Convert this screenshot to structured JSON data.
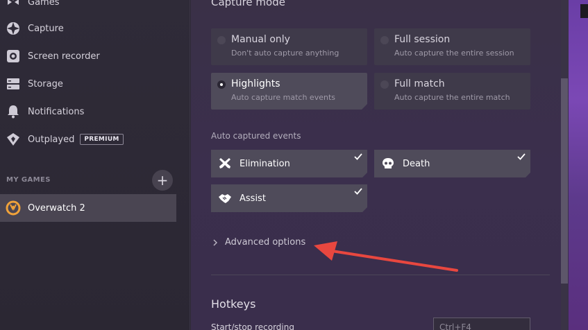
{
  "sidebar": {
    "items": [
      {
        "label": "Games",
        "icon": "gamepad-icon"
      },
      {
        "label": "Capture",
        "icon": "aperture-icon"
      },
      {
        "label": "Screen recorder",
        "icon": "record-icon"
      },
      {
        "label": "Storage",
        "icon": "storage-icon"
      },
      {
        "label": "Notifications",
        "icon": "bell-icon"
      },
      {
        "label": "Outplayed",
        "icon": "outplayed-logo-icon",
        "badge": "PREMIUM"
      }
    ],
    "my_games_label": "MY GAMES",
    "add_game_symbol": "+",
    "games": [
      {
        "label": "Overwatch 2",
        "icon": "overwatch-icon",
        "selected": true
      }
    ]
  },
  "capture_mode": {
    "heading": "Capture mode",
    "options": [
      {
        "title": "Manual only",
        "subtitle": "Don't auto capture anything",
        "selected": false
      },
      {
        "title": "Full session",
        "subtitle": "Auto capture the entire session",
        "selected": false
      },
      {
        "title": "Highlights",
        "subtitle": "Auto capture match events",
        "selected": true
      },
      {
        "title": "Full match",
        "subtitle": "Auto capture the entire match",
        "selected": false
      }
    ]
  },
  "auto_events": {
    "label": "Auto captured events",
    "events": [
      {
        "label": "Elimination",
        "icon": "crossed-guns-icon",
        "checked": true
      },
      {
        "label": "Death",
        "icon": "skull-icon",
        "checked": true
      },
      {
        "label": "Assist",
        "icon": "handshake-icon",
        "checked": true
      }
    ]
  },
  "advanced_options": {
    "label": "Advanced options"
  },
  "hotkeys": {
    "heading": "Hotkeys",
    "start_stop_label": "Start/stop recording",
    "start_stop_value": "Ctrl+F4"
  },
  "colors": {
    "accent_arrow": "#e8473f",
    "selected_card": "#4f4b5a",
    "backdrop_purple": "#6a3ea6"
  }
}
